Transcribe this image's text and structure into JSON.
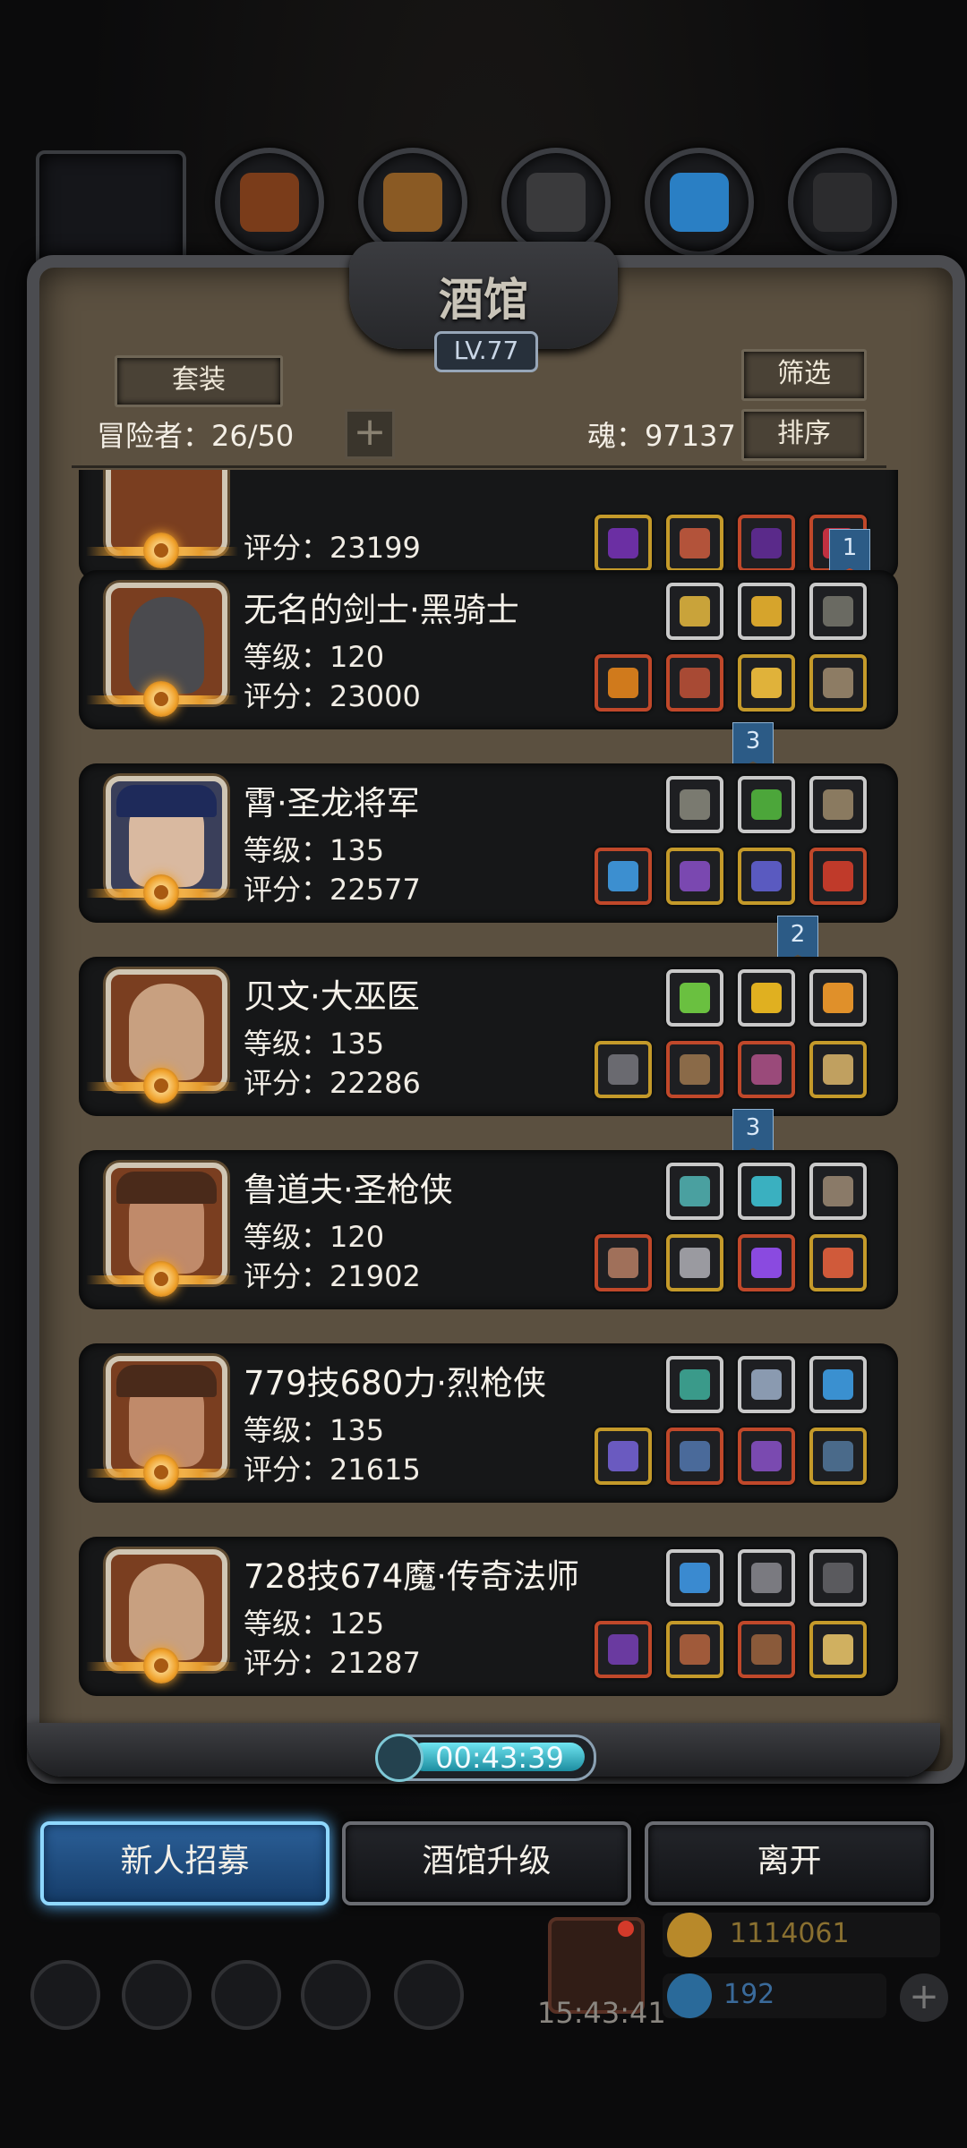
{
  "header": {
    "title": "酒馆",
    "level": "LV.77",
    "outfit_label": "套装",
    "filter_label": "筛选",
    "sort_label": "排序",
    "adventurers_label": "冒险者：26/50",
    "add_label": "+",
    "soul_label": "魂：97137"
  },
  "heroes": [
    {
      "name": "",
      "level": "",
      "score": "评分：23199"
    },
    {
      "name": "无名的剑士·黑骑士",
      "level": "等级：120",
      "score": "评分：23000",
      "rank": "1"
    },
    {
      "name": "霄·圣龙将军",
      "level": "等级：135",
      "score": "评分：22577",
      "rank": "3"
    },
    {
      "name": "贝文·大巫医",
      "level": "等级：135",
      "score": "评分：22286",
      "rank": "2"
    },
    {
      "name": "鲁道夫·圣枪侠",
      "level": "等级：120",
      "score": "评分：21902",
      "rank": "3"
    },
    {
      "name": "779技680力·烈枪侠",
      "level": "等级：135",
      "score": "评分：21615"
    },
    {
      "name": "728技674魔·传奇法师",
      "level": "等级：125",
      "score": "评分：21287"
    }
  ],
  "timer": "00:43:39",
  "buttons": {
    "recruit": "新人招募",
    "upgrade": "酒馆升级",
    "leave": "离开"
  },
  "footer": {
    "clock": "15:43:41",
    "gold": "1114061",
    "gems": "192"
  },
  "colors": {
    "accent_blue": "#2b5f97",
    "gold_border": "#c49a2a",
    "red_border": "#c0482a",
    "frame": "#4b4c50",
    "parchment": "#5b5040"
  }
}
